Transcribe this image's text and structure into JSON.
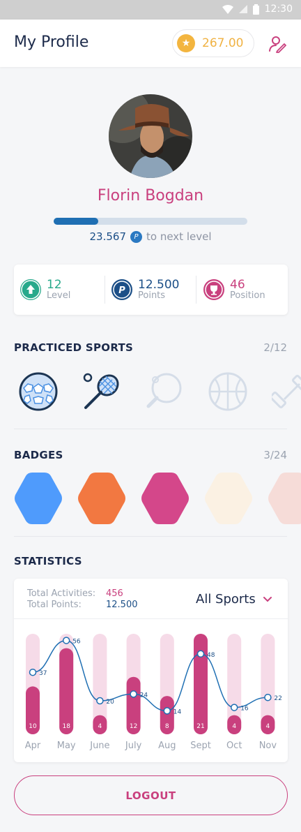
{
  "status_bar": {
    "time": "12:30"
  },
  "header": {
    "title": "My Profile",
    "coins": "267.00"
  },
  "profile": {
    "name": "Florin Bogdan",
    "level_progress": 0.23,
    "points_to_next": "23.567",
    "points_to_next_label": "to next level"
  },
  "stats": [
    {
      "value": "12",
      "label": "Level",
      "icon": "arrow-up-icon",
      "color": "#27a98b"
    },
    {
      "value": "12.500",
      "label": "Points",
      "icon": "points-icon",
      "color": "#1c4f87"
    },
    {
      "value": "46",
      "label": "Position",
      "icon": "trophy-icon",
      "color": "#c9407e"
    }
  ],
  "sports": {
    "title": "PRACTICED SPORTS",
    "count": "2/12",
    "items": [
      {
        "name": "football-icon",
        "active": true
      },
      {
        "name": "tennis-icon",
        "active": true
      },
      {
        "name": "ping-pong-icon",
        "active": false
      },
      {
        "name": "basketball-icon",
        "active": false
      },
      {
        "name": "fitness-icon",
        "active": false
      }
    ]
  },
  "badges": {
    "title": "BADGES",
    "count": "3/24",
    "colors": [
      "#4f9bfc",
      "#f27841",
      "#d4478a",
      "#fbf1e3",
      "#f6dcd8"
    ]
  },
  "statistics": {
    "title": "STATISTICS",
    "total_activities_label": "Total Activities:",
    "total_activities": "456",
    "total_points_label": "Total Points:",
    "total_points": "12.500",
    "filter": "All Sports"
  },
  "chart_data": {
    "type": "bar",
    "categories": [
      "Apr",
      "May",
      "June",
      "July",
      "Aug",
      "Sept",
      "Oct",
      "Nov"
    ],
    "series": [
      {
        "values": [
          10,
          18,
          4,
          12,
          8,
          21,
          4,
          4
        ]
      },
      {
        "type": "line",
        "values": [
          37,
          56,
          20,
          24,
          14,
          48,
          16,
          22
        ]
      }
    ],
    "bar_max": 21,
    "line_max": 60
  },
  "logout_label": "LOGOUT"
}
